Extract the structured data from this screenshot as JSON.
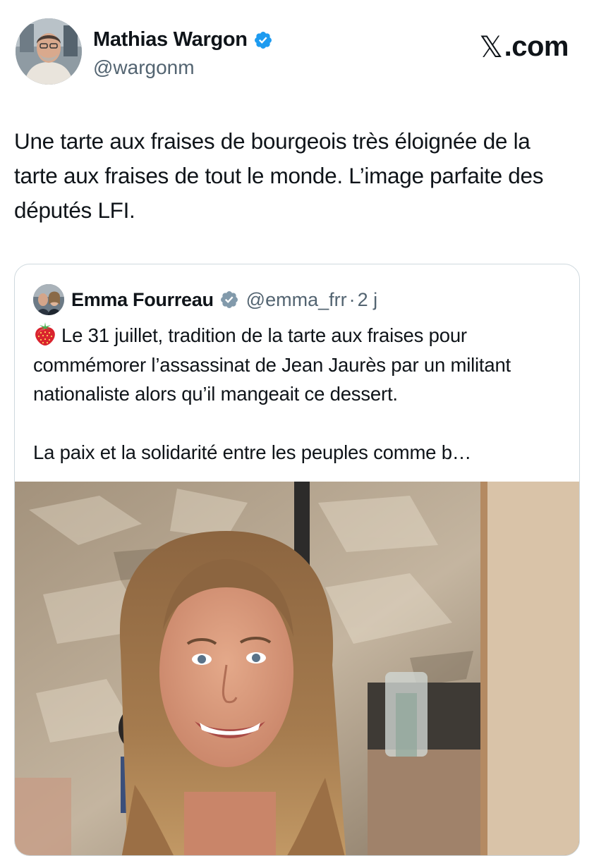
{
  "author": {
    "name": "Mathias Wargon",
    "handle": "@wargonm"
  },
  "brand": {
    "mark": "𝕏",
    "text": ".com"
  },
  "tweet": {
    "text": "Une tarte aux fraises de bourgeois très éloignée de la tarte aux fraises de tout le monde. L’image parfaite des députés LFI."
  },
  "quoted": {
    "name": "Emma Fourreau",
    "handle": "@emma_frr",
    "separator": "·",
    "time": "2 j",
    "paragraph1": "Le 31 juillet, tradition de la tarte aux fraises pour commémorer l’assassinat de Jean Jaurès par un militant nationaliste alors qu’il mangeait ce dessert.",
    "paragraph2": "La paix et la solidarité entre les peuples comme b…"
  },
  "colors": {
    "text": "#0f1419",
    "secondary": "#536471",
    "verified": "#1d9bf0",
    "verified_gray": "#829aab",
    "border": "#cfd9de"
  },
  "icons": {
    "verified": "verified-badge-icon",
    "quoted_verified": "gray-verified-badge-icon",
    "emoji": "strawberry-icon"
  }
}
